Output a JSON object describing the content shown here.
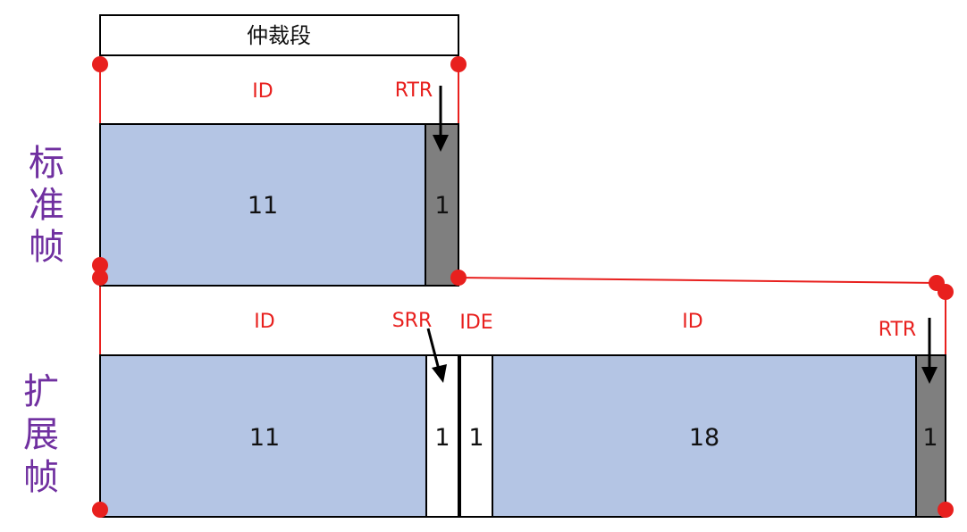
{
  "arbitration_label": "仲裁段",
  "standard_frame": {
    "side_label": [
      "标",
      "准",
      "帧"
    ],
    "field_labels": {
      "id": "ID",
      "rtr": "RTR"
    },
    "cells": {
      "id_bits": "11",
      "rtr_bits": "1"
    }
  },
  "extended_frame": {
    "side_label": [
      "扩",
      "展",
      "帧"
    ],
    "field_labels": {
      "id_base": "ID",
      "srr": "SRR",
      "ide": "IDE",
      "id_ext": "ID",
      "rtr": "RTR"
    },
    "cells": {
      "id_base_bits": "11",
      "srr_bits": "1",
      "ide_bits": "1",
      "id_ext_bits": "18",
      "rtr_bits": "1"
    }
  },
  "colors": {
    "id_fill": "#b4c5e4",
    "rtr_fill": "#7f7f7f",
    "accent_red": "#e8201e",
    "side_label": "#7030a0"
  }
}
